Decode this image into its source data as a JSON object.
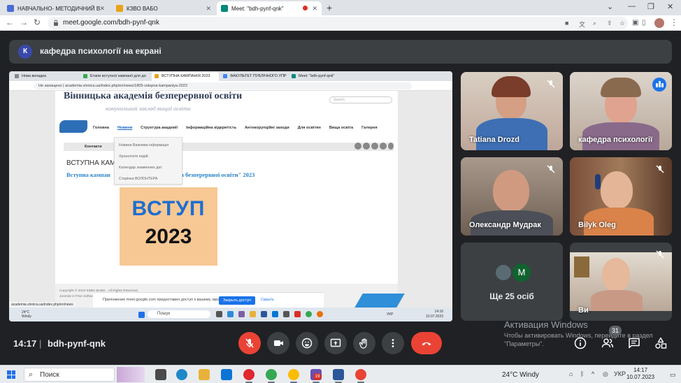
{
  "browser": {
    "tabs": [
      {
        "label": "НАВЧАЛЬНО- МЕТОДИЧНИЙ В",
        "favicon_color": "#4b6bd6"
      },
      {
        "label": "КЗВО ВАБО",
        "favicon_color": "#e8a317"
      },
      {
        "label": "Meet: \"bdh-pynf-qnk\"",
        "favicon_color": "#00897b",
        "active": true
      }
    ],
    "url": "meet.google.com/bdh-pynf-qnk"
  },
  "presenting_banner": {
    "initial": "К",
    "text": "кафедра психології на екрані"
  },
  "shared_screen": {
    "tabs": [
      {
        "label": "Нова вкладка",
        "color": "#888888"
      },
      {
        "label": "Етапи вступної кампанії для до",
        "color": "#34a853"
      },
      {
        "label": "ВСТУПНА КАМПАНІЯ 2023",
        "color": "#e8a317",
        "active": true
      },
      {
        "label": "ФАКУЛЬТЕТ ПУБЛІЧНОГО УПР",
        "color": "#4285f4"
      },
      {
        "label": "Meet: \"bdh-pynf-qnk\"",
        "color": "#00897b"
      }
    ],
    "url_prefix": "Не захищено",
    "url": "academia.vinnica.ua/index.php/en/news/1805-vstupna-kampaniya-2023",
    "site": {
      "title": "Вінницька академія безперервної освіти",
      "subtitle": "комунальний заклад вищої освіти",
      "search_placeholder": "Search",
      "nav": [
        "Головна",
        "Новини",
        "Структура академії",
        "Інформаційна відкритість",
        "Антикорупційні заходи",
        "Для освітян",
        "Вища освіта",
        "Галерея"
      ],
      "contacts": "Контакти",
      "dropdown": [
        "Новини Важлива інформація",
        "Хронологія подій",
        "Календар знаменних дат",
        "Сторінка ВОЛОНТЕРА"
      ],
      "heading": "ВСТУПНА КАМ",
      "subheading_left": "Вступна кампан",
      "subheading_right": "адемія безперервної освіти\" 2023",
      "banner_line1": "ВСТУП",
      "banner_line2": "2023",
      "footer_line1": "Copyright © 2023 КЗВО ВАБО . All Rights Reserved.",
      "footer_line2": "Joomla! is Free Software released under the GNU Gene"
    },
    "share_bar": {
      "message": "Приложение meet.google.com предоставил доступ к вашему экрану.",
      "stop_button": "Закрыть доступ",
      "hide_button": "Скрыть"
    },
    "status_url": "academia.vinnica.ua/index.php/en/news",
    "taskbar": {
      "weather": "24°C\nWindy",
      "search": "Пошук",
      "lang": "УКР",
      "time": "14:16",
      "date": "10.07.2023"
    }
  },
  "participants": [
    {
      "name": "Tatiana Drozd",
      "muted": true
    },
    {
      "name": "кафедра психології",
      "speaking": true
    },
    {
      "name": "Олександр Мудрак",
      "muted": true
    },
    {
      "name": "Bilyk Oleg",
      "muted": true
    },
    {
      "name": "Ви",
      "muted": true
    }
  ],
  "others": {
    "initial": "M",
    "label": "Ще 25 осіб"
  },
  "activation": {
    "title": "Активация Windows",
    "line1": "Чтобы активировать Windows, перейдите в раздел",
    "line2": "\"Параметры\"."
  },
  "meet_bar": {
    "time": "14:17",
    "separator": "|",
    "code": "bdh-pynf-qnk",
    "people_count": "31",
    "controls": [
      "mic-off",
      "camera",
      "emoji",
      "present",
      "raise-hand",
      "more",
      "end-call"
    ]
  },
  "taskbar": {
    "search": "Поиск",
    "badge": "19",
    "weather": "24°C  Windy",
    "lang": "УКР",
    "time": "14:17",
    "date": "10.07.2023"
  },
  "colors": {
    "meet_bg": "#202124",
    "danger": "#ea4335",
    "accent": "#8ab4f8"
  }
}
